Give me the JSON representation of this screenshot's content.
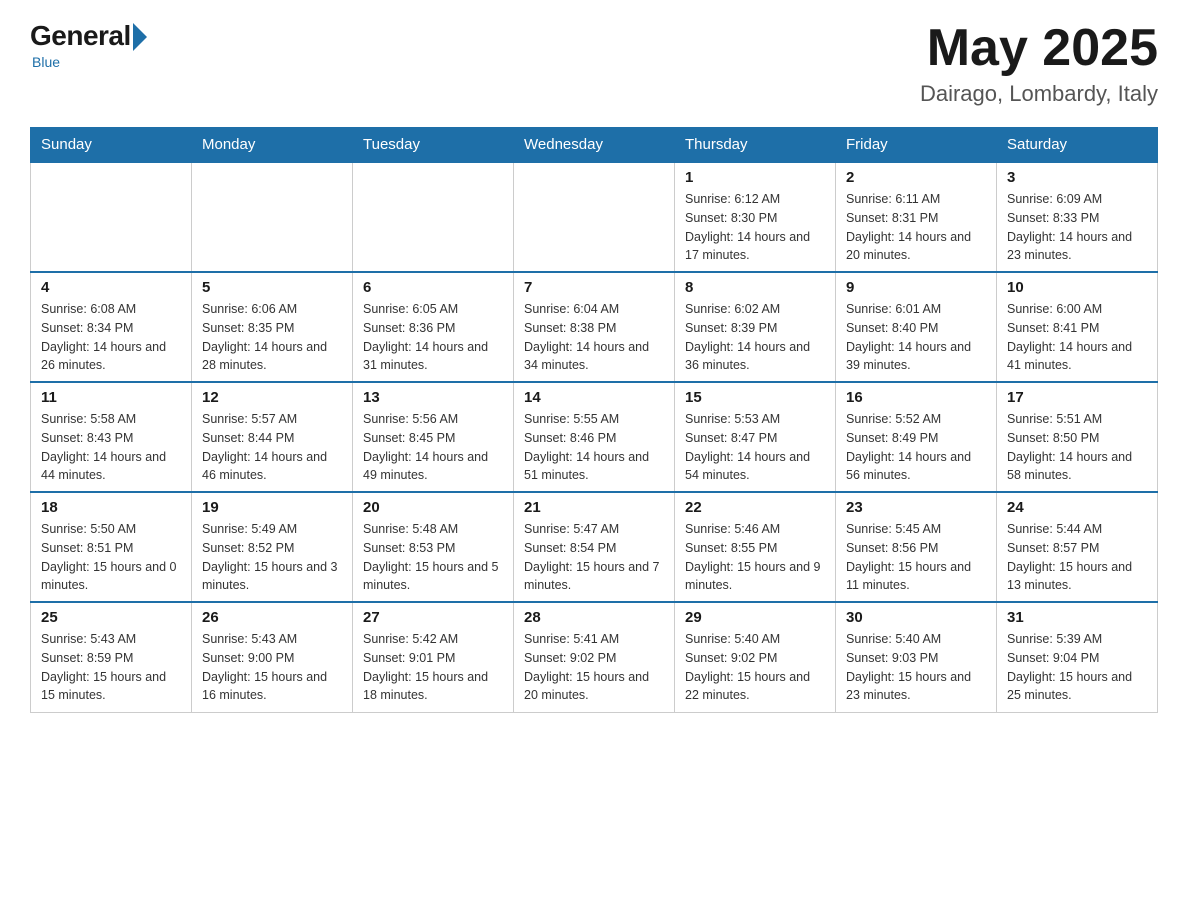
{
  "logo": {
    "general": "General",
    "blue": "Blue",
    "subtitle": "Blue"
  },
  "header": {
    "month_year": "May 2025",
    "location": "Dairago, Lombardy, Italy"
  },
  "weekdays": [
    "Sunday",
    "Monday",
    "Tuesday",
    "Wednesday",
    "Thursday",
    "Friday",
    "Saturday"
  ],
  "weeks": [
    [
      {
        "day": "",
        "info": ""
      },
      {
        "day": "",
        "info": ""
      },
      {
        "day": "",
        "info": ""
      },
      {
        "day": "",
        "info": ""
      },
      {
        "day": "1",
        "info": "Sunrise: 6:12 AM\nSunset: 8:30 PM\nDaylight: 14 hours and 17 minutes."
      },
      {
        "day": "2",
        "info": "Sunrise: 6:11 AM\nSunset: 8:31 PM\nDaylight: 14 hours and 20 minutes."
      },
      {
        "day": "3",
        "info": "Sunrise: 6:09 AM\nSunset: 8:33 PM\nDaylight: 14 hours and 23 minutes."
      }
    ],
    [
      {
        "day": "4",
        "info": "Sunrise: 6:08 AM\nSunset: 8:34 PM\nDaylight: 14 hours and 26 minutes."
      },
      {
        "day": "5",
        "info": "Sunrise: 6:06 AM\nSunset: 8:35 PM\nDaylight: 14 hours and 28 minutes."
      },
      {
        "day": "6",
        "info": "Sunrise: 6:05 AM\nSunset: 8:36 PM\nDaylight: 14 hours and 31 minutes."
      },
      {
        "day": "7",
        "info": "Sunrise: 6:04 AM\nSunset: 8:38 PM\nDaylight: 14 hours and 34 minutes."
      },
      {
        "day": "8",
        "info": "Sunrise: 6:02 AM\nSunset: 8:39 PM\nDaylight: 14 hours and 36 minutes."
      },
      {
        "day": "9",
        "info": "Sunrise: 6:01 AM\nSunset: 8:40 PM\nDaylight: 14 hours and 39 minutes."
      },
      {
        "day": "10",
        "info": "Sunrise: 6:00 AM\nSunset: 8:41 PM\nDaylight: 14 hours and 41 minutes."
      }
    ],
    [
      {
        "day": "11",
        "info": "Sunrise: 5:58 AM\nSunset: 8:43 PM\nDaylight: 14 hours and 44 minutes."
      },
      {
        "day": "12",
        "info": "Sunrise: 5:57 AM\nSunset: 8:44 PM\nDaylight: 14 hours and 46 minutes."
      },
      {
        "day": "13",
        "info": "Sunrise: 5:56 AM\nSunset: 8:45 PM\nDaylight: 14 hours and 49 minutes."
      },
      {
        "day": "14",
        "info": "Sunrise: 5:55 AM\nSunset: 8:46 PM\nDaylight: 14 hours and 51 minutes."
      },
      {
        "day": "15",
        "info": "Sunrise: 5:53 AM\nSunset: 8:47 PM\nDaylight: 14 hours and 54 minutes."
      },
      {
        "day": "16",
        "info": "Sunrise: 5:52 AM\nSunset: 8:49 PM\nDaylight: 14 hours and 56 minutes."
      },
      {
        "day": "17",
        "info": "Sunrise: 5:51 AM\nSunset: 8:50 PM\nDaylight: 14 hours and 58 minutes."
      }
    ],
    [
      {
        "day": "18",
        "info": "Sunrise: 5:50 AM\nSunset: 8:51 PM\nDaylight: 15 hours and 0 minutes."
      },
      {
        "day": "19",
        "info": "Sunrise: 5:49 AM\nSunset: 8:52 PM\nDaylight: 15 hours and 3 minutes."
      },
      {
        "day": "20",
        "info": "Sunrise: 5:48 AM\nSunset: 8:53 PM\nDaylight: 15 hours and 5 minutes."
      },
      {
        "day": "21",
        "info": "Sunrise: 5:47 AM\nSunset: 8:54 PM\nDaylight: 15 hours and 7 minutes."
      },
      {
        "day": "22",
        "info": "Sunrise: 5:46 AM\nSunset: 8:55 PM\nDaylight: 15 hours and 9 minutes."
      },
      {
        "day": "23",
        "info": "Sunrise: 5:45 AM\nSunset: 8:56 PM\nDaylight: 15 hours and 11 minutes."
      },
      {
        "day": "24",
        "info": "Sunrise: 5:44 AM\nSunset: 8:57 PM\nDaylight: 15 hours and 13 minutes."
      }
    ],
    [
      {
        "day": "25",
        "info": "Sunrise: 5:43 AM\nSunset: 8:59 PM\nDaylight: 15 hours and 15 minutes."
      },
      {
        "day": "26",
        "info": "Sunrise: 5:43 AM\nSunset: 9:00 PM\nDaylight: 15 hours and 16 minutes."
      },
      {
        "day": "27",
        "info": "Sunrise: 5:42 AM\nSunset: 9:01 PM\nDaylight: 15 hours and 18 minutes."
      },
      {
        "day": "28",
        "info": "Sunrise: 5:41 AM\nSunset: 9:02 PM\nDaylight: 15 hours and 20 minutes."
      },
      {
        "day": "29",
        "info": "Sunrise: 5:40 AM\nSunset: 9:02 PM\nDaylight: 15 hours and 22 minutes."
      },
      {
        "day": "30",
        "info": "Sunrise: 5:40 AM\nSunset: 9:03 PM\nDaylight: 15 hours and 23 minutes."
      },
      {
        "day": "31",
        "info": "Sunrise: 5:39 AM\nSunset: 9:04 PM\nDaylight: 15 hours and 25 minutes."
      }
    ]
  ]
}
